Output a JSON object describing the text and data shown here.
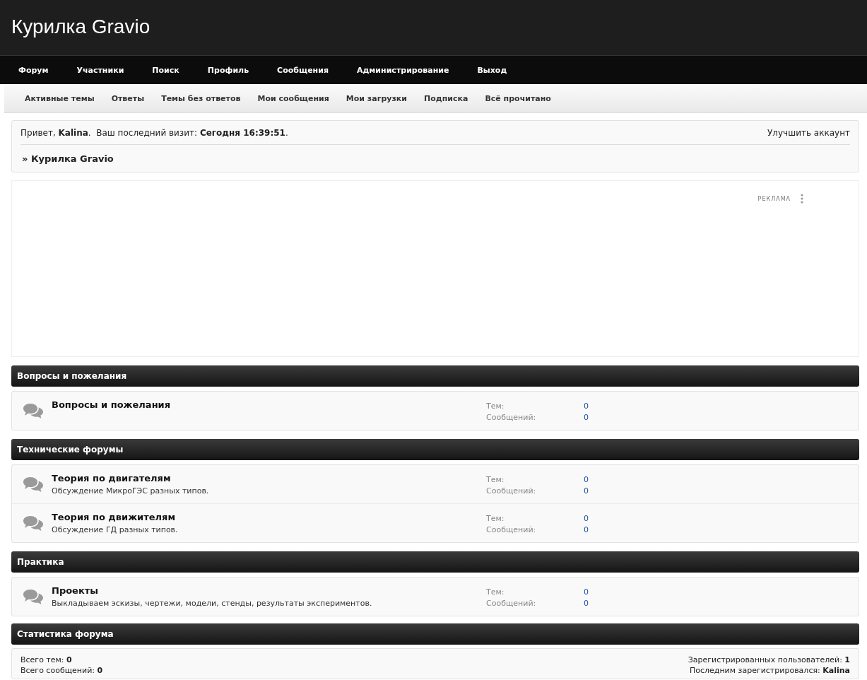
{
  "site": {
    "title": "Курилка Gravio"
  },
  "nav": [
    {
      "label": "Форум"
    },
    {
      "label": "Участники"
    },
    {
      "label": "Поиск"
    },
    {
      "label": "Профиль"
    },
    {
      "label": "Сообщения"
    },
    {
      "label": "Администрирование"
    },
    {
      "label": "Выход"
    }
  ],
  "subnav": [
    {
      "label": "Активные темы"
    },
    {
      "label": "Ответы"
    },
    {
      "label": "Темы без ответов"
    },
    {
      "label": "Мои сообщения"
    },
    {
      "label": "Мои загрузки"
    },
    {
      "label": "Подписка"
    },
    {
      "label": "Всё прочитано"
    }
  ],
  "info": {
    "greeting": "Привет, **Kalina**.  Ваш последний визит: **Сегодня 16:39:51**.",
    "upgrade_link": "Улучшить аккаунт",
    "breadcrumb": "» Курилка Gravio"
  },
  "ad": {
    "label": "РЕКЛАМА"
  },
  "categories": [
    {
      "title": "Вопросы и пожелания",
      "forums": [
        {
          "name": "Вопросы и пожелания",
          "topics_label": "Тем:",
          "topics": "0",
          "posts_label": "Сообщений:",
          "posts": "0"
        }
      ]
    },
    {
      "title": "Технические форумы",
      "forums": [
        {
          "name": "Теория по двигателям",
          "description": "Обсуждение МикроГЭС разных типов.",
          "topics_label": "Тем:",
          "topics": "0",
          "posts_label": "Сообщений:",
          "posts": "0"
        },
        {
          "name": "Теория по движителям",
          "description": "Обсуждение ГД разных типов.",
          "topics_label": "Тем:",
          "topics": "0",
          "posts_label": "Сообщений:",
          "posts": "0"
        }
      ]
    },
    {
      "title": "Практика",
      "forums": [
        {
          "name": "Проекты",
          "description": "Выкладываем эскизы, чертежи, модели, стенды, результаты экспериментов.",
          "topics_label": "Тем:",
          "topics": "0",
          "posts_label": "Сообщений:",
          "posts": "0"
        }
      ]
    }
  ],
  "stats": {
    "title": "Статистика форума",
    "left": [
      "Всего тем: **0**",
      "Всего сообщений: **0**"
    ],
    "right": [
      "Зарегистрированных пользователей: **1**",
      "Последним зарегистрировался: **Kalina**"
    ]
  }
}
